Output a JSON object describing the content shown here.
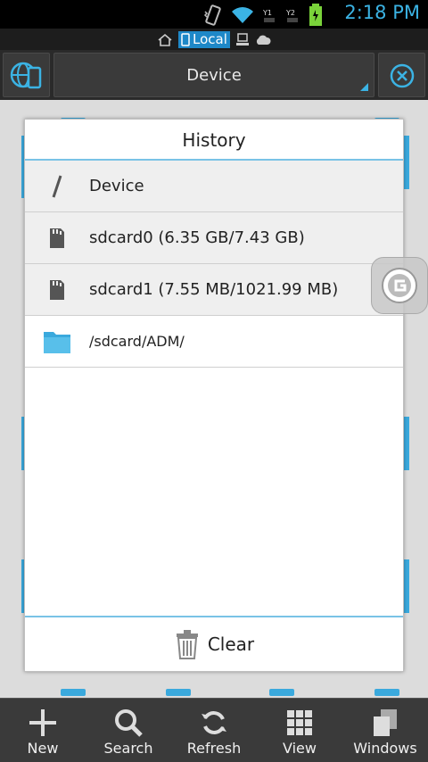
{
  "status_bar": {
    "time": "2:18 PM"
  },
  "path_bar": {
    "location_label": "Local"
  },
  "toolbar": {
    "title": "Device"
  },
  "dialog": {
    "title": "History",
    "items": [
      {
        "label": "Device",
        "icon": "root-slash-icon"
      },
      {
        "label": "sdcard0 (6.35 GB/7.43 GB)",
        "icon": "sdcard-icon"
      },
      {
        "label": "sdcard1 (7.55 MB/1021.99 MB)",
        "icon": "sdcard-icon"
      },
      {
        "label": "/sdcard/ADM/",
        "icon": "folder-icon"
      }
    ],
    "clear_label": "Clear"
  },
  "bottom_nav": {
    "items": [
      {
        "label": "New",
        "icon": "plus-icon"
      },
      {
        "label": "Search",
        "icon": "search-icon"
      },
      {
        "label": "Refresh",
        "icon": "refresh-icon"
      },
      {
        "label": "View",
        "icon": "grid-icon"
      },
      {
        "label": "Windows",
        "icon": "windows-icon"
      }
    ]
  },
  "colors": {
    "accent": "#3bb3e4",
    "highlight": "#1e88c8"
  }
}
